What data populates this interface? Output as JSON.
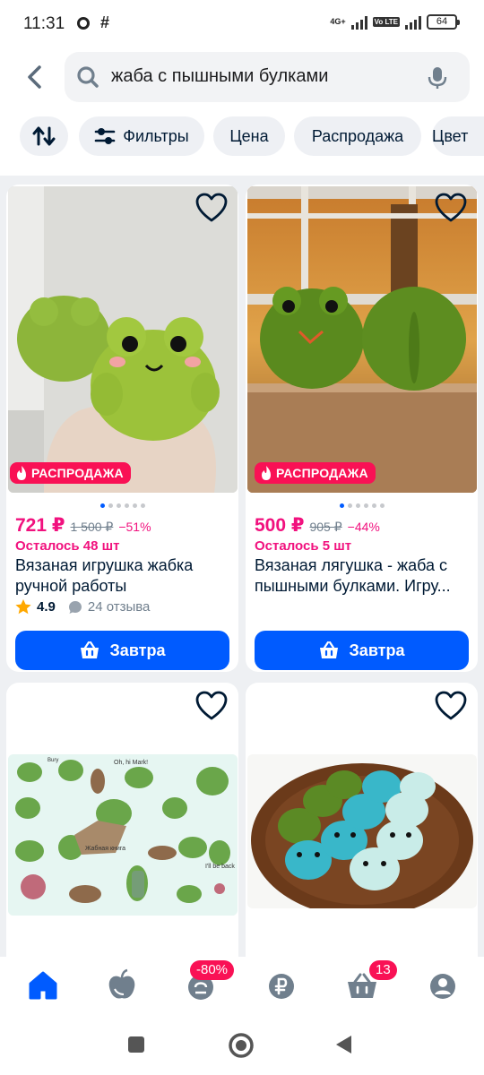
{
  "status_bar": {
    "time": "11:31",
    "battery": "64",
    "network": "4G+",
    "volte": "Vo LTE"
  },
  "search": {
    "query": "жаба с пышными булками"
  },
  "chips": {
    "filters": "Фильтры",
    "price": "Цена",
    "sale": "Распродажа",
    "color": "Цвет"
  },
  "products": [
    {
      "price": "721 ₽",
      "old_price": "1 500 ₽",
      "discount": "−51%",
      "stock": "Осталось 48 шт",
      "title": "Вязаная игрушка жабка ручной работы",
      "rating": "4.9",
      "reviews": "24 отзыва",
      "badge": "РАСПРОДАЖА",
      "button": "Завтра"
    },
    {
      "price": "500 ₽",
      "old_price": "905 ₽",
      "discount": "−44%",
      "stock": "Осталось 5 шт",
      "title": "Вязаная лягушка - жаба с пышными булками. Игру...",
      "badge": "РАСПРОДАЖА",
      "button": "Завтра"
    }
  ],
  "sticker_sheet": {
    "t1": "Oh, hi Mark!",
    "t2": "Жабная книга",
    "t3": "I'll be back",
    "t4": "Bury"
  },
  "nav": {
    "promo_badge": "-80%",
    "cart_badge": "13"
  },
  "colors": {
    "brand_blue": "#005bff",
    "accent_pink": "#f91155",
    "price_pink": "#f1117e"
  }
}
